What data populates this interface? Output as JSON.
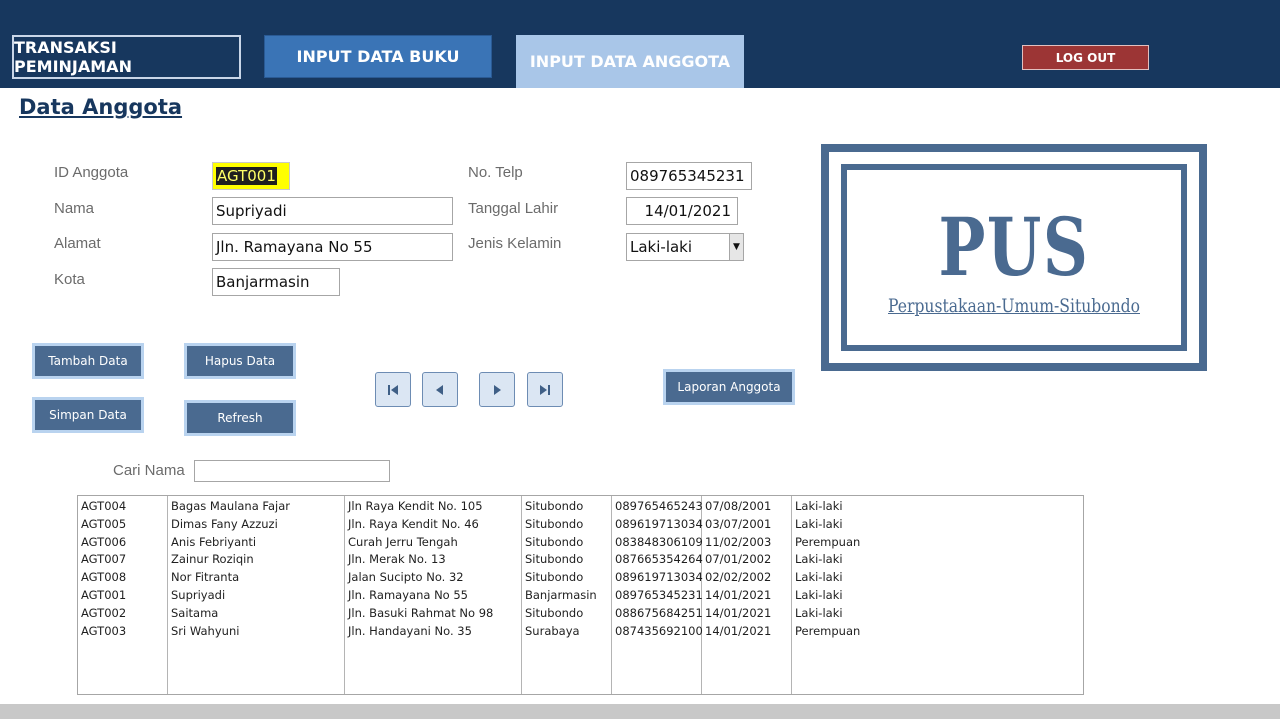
{
  "tabs": {
    "transaksi": "TRANSAKSI PEMINJAMAN",
    "buku": "INPUT DATA BUKU",
    "anggota": "INPUT DATA ANGGOTA"
  },
  "logout_label": "LOG OUT",
  "page_title": "Data Anggota",
  "form": {
    "id_label": "ID Anggota",
    "id_value": "AGT001",
    "nama_label": "Nama",
    "nama_value": "Supriyadi",
    "alamat_label": "Alamat",
    "alamat_value": "Jln. Ramayana No 55",
    "kota_label": "Kota",
    "kota_value": "Banjarmasin",
    "telp_label": "No. Telp",
    "telp_value": "089765345231",
    "lahir_label": "Tanggal Lahir",
    "lahir_value": "14/01/2021",
    "kelamin_label": "Jenis Kelamin",
    "kelamin_value": "Laki-laki"
  },
  "buttons": {
    "tambah": "Tambah Data",
    "hapus": "Hapus Data",
    "simpan": "Simpan Data",
    "refresh": "Refresh",
    "laporan": "Laporan Anggota"
  },
  "logo": {
    "big": "PUS",
    "sub": "Perpustakaan-Umum-Situbondo"
  },
  "search": {
    "label": "Cari Nama",
    "value": ""
  },
  "members": [
    [
      "AGT004",
      "Bagas Maulana Fajar",
      "Jln Raya Kendit No. 105",
      "Situbondo",
      "089765465243",
      "07/08/2001",
      "Laki-laki"
    ],
    [
      "AGT005",
      "Dimas Fany Azzuzi",
      "Jln. Raya Kendit No. 46",
      "Situbondo",
      "089619713034",
      "03/07/2001",
      "Laki-laki"
    ],
    [
      "AGT006",
      "Anis Febriyanti",
      "Curah Jerru Tengah",
      "Situbondo",
      "083848306109",
      "11/02/2003",
      "Perempuan"
    ],
    [
      "AGT007",
      "Zainur Roziqin",
      "Jln. Merak No. 13",
      "Situbondo",
      "087665354264",
      "07/01/2002",
      "Laki-laki"
    ],
    [
      "AGT008",
      "Nor Fitranta",
      "Jalan Sucipto No. 32",
      "Situbondo",
      "089619713034",
      "02/02/2002",
      "Laki-laki"
    ],
    [
      "AGT001",
      "Supriyadi",
      "Jln. Ramayana No 55",
      "Banjarmasin",
      "089765345231",
      "14/01/2021",
      "Laki-laki"
    ],
    [
      "AGT002",
      "Saitama",
      "Jln. Basuki Rahmat No 98",
      "Situbondo",
      "088675684251",
      "14/01/2021",
      "Laki-laki"
    ],
    [
      "AGT003",
      "Sri Wahyuni",
      "Jln. Handayani No. 35",
      "Surabaya",
      "087435692100",
      "14/01/2021",
      "Perempuan"
    ]
  ]
}
